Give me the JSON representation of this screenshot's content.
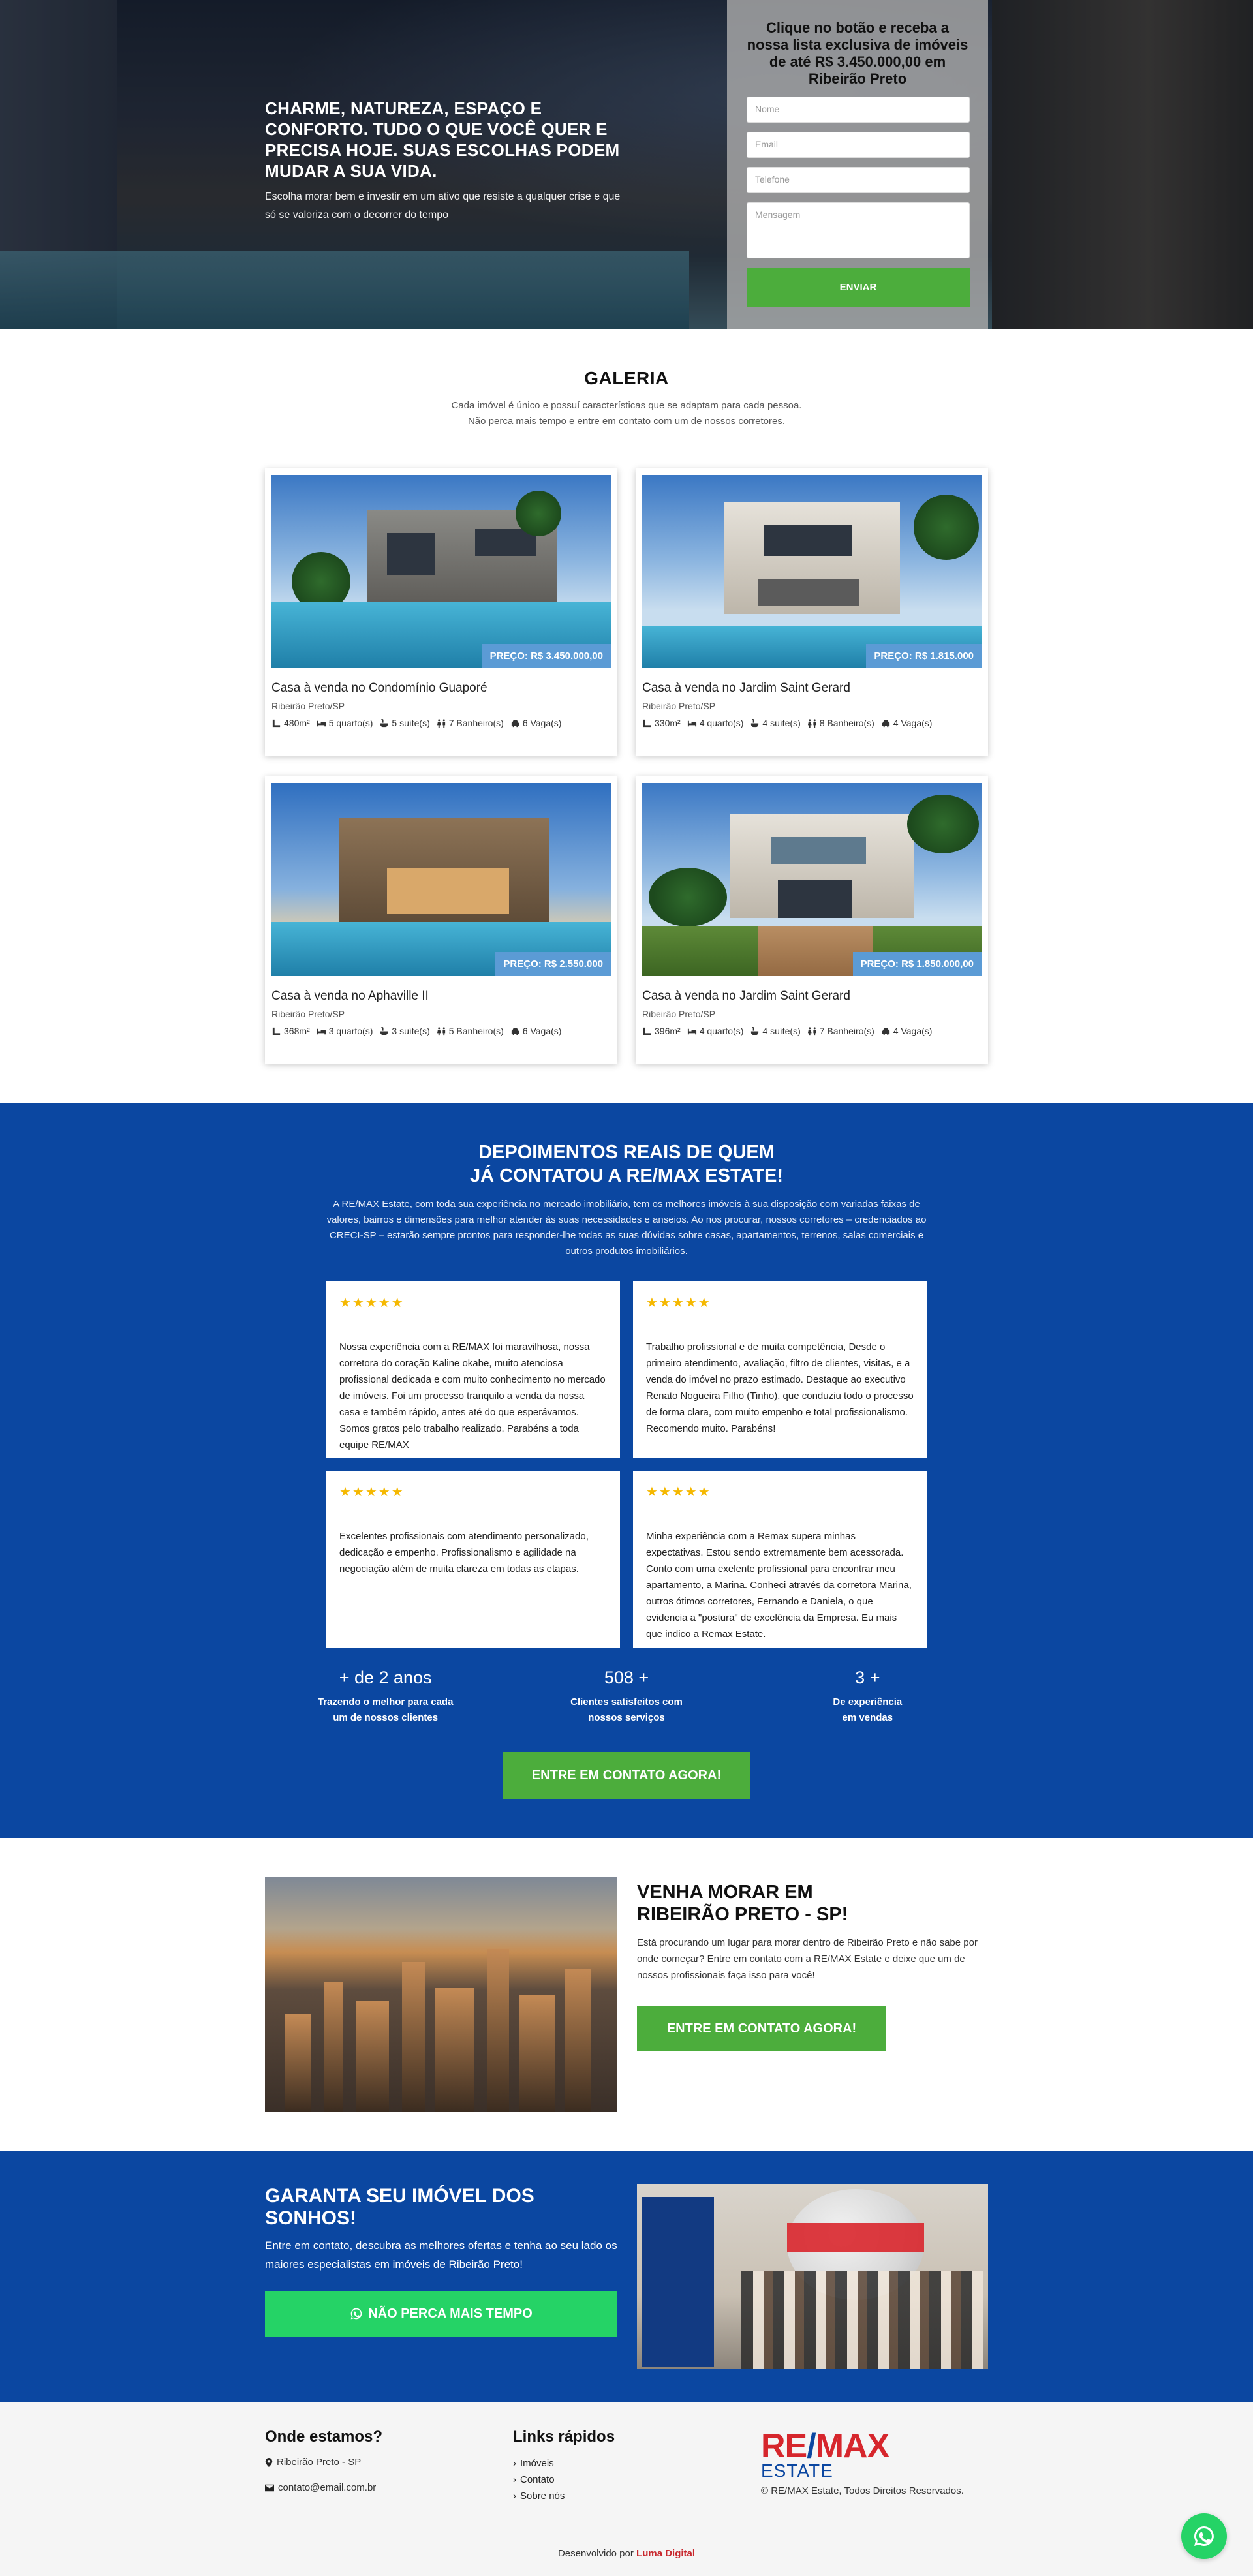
{
  "hero": {
    "headline": "CHARME, NATUREZA, ESPAÇO E CONFORTO. TUDO O QUE VOCÊ QUER E PRECISA HOJE. SUAS ESCOLHAS PODEM MUDAR A SUA VIDA.",
    "text": "Escolha morar bem e investir em um ativo que resiste a qualquer crise e que só se valoriza com o decorrer do tempo"
  },
  "form": {
    "title": "Clique no botão e receba a nossa lista exclusiva de imóveis de até R$ 3.450.000,00 em Ribeirão Preto",
    "name_placeholder": "Nome",
    "email_placeholder": "Email",
    "phone_placeholder": "Telefone",
    "message_placeholder": "Mensagem",
    "submit": "ENVIAR"
  },
  "gallery": {
    "title": "GALERIA",
    "subtitle_1": "Cada imóvel é único e possuí características que se adaptam para cada pessoa.",
    "subtitle_2": "Não perca mais tempo e entre em contato com um de nossos corretores.",
    "cards": [
      {
        "price": "PREÇO: R$ 3.450.000,00",
        "title": "Casa à venda no Condomínio Guaporé",
        "city": "Ribeirão Preto/SP",
        "area": "480m²",
        "bedrooms": "5 quarto(s)",
        "suites": "5 suíte(s)",
        "bathrooms": "7 Banheiro(s)",
        "parking": "6 Vaga(s)"
      },
      {
        "price": "PREÇO: R$ 1.815.000",
        "title": "Casa à venda no Jardim Saint Gerard",
        "city": "Ribeirão Preto/SP",
        "area": "330m²",
        "bedrooms": "4 quarto(s)",
        "suites": "4 suíte(s)",
        "bathrooms": "8 Banheiro(s)",
        "parking": "4 Vaga(s)"
      },
      {
        "price": "PREÇO: R$ 2.550.000",
        "title": "Casa à venda no Aphaville II",
        "city": "Ribeirão Preto/SP",
        "area": "368m²",
        "bedrooms": "3 quarto(s)",
        "suites": "3 suíte(s)",
        "bathrooms": "5 Banheiro(s)",
        "parking": "6 Vaga(s)"
      },
      {
        "price": "PREÇO: R$ 1.850.000,00",
        "title": "Casa à venda no Jardim Saint Gerard",
        "city": "Ribeirão Preto/SP",
        "area": "396m²",
        "bedrooms": "4 quarto(s)",
        "suites": "4 suíte(s)",
        "bathrooms": "7 Banheiro(s)",
        "parking": "4 Vaga(s)"
      }
    ]
  },
  "testimonials": {
    "title_1": "DEPOIMENTOS REAIS DE QUEM",
    "title_2": "JÁ CONTATOU A RE/MAX ESTATE!",
    "lead": "A RE/MAX Estate, com toda sua experiência no mercado imobiliário, tem os melhores imóveis à sua disposição com variadas faixas de valores, bairros e dimensões para melhor atender às suas necessidades e anseios. Ao nos procurar, nossos corretores – credenciados ao CRECI-SP – estarão sempre prontos para responder-lhe todas as suas dúvidas sobre casas, apartamentos, terrenos, salas comerciais e outros produtos imobiliários.",
    "stars": "★★★★★",
    "items": [
      {
        "text": "Nossa experiência com a RE/MAX foi maravilhosa, nossa corretora do coração Kaline okabe, muito atenciosa profissional dedicada e com muito conhecimento no mercado de imóveis. Foi um processo tranquilo a venda da nossa casa e também rápido, antes até do que esperávamos. Somos gratos pelo trabalho realizado. Parabéns a toda equipe RE/MAX"
      },
      {
        "text": "Trabalho profissional e de muita competência, Desde o primeiro atendimento, avaliação, filtro de clientes, visitas, e a venda do imóvel no prazo estimado. Destaque ao executivo Renato Nogueira Filho (Tinho), que conduziu todo o processo de forma clara, com muito empenho e total profissionalismo. Recomendo muito. Parabéns!"
      },
      {
        "text": "Excelentes profissionais com atendimento personalizado, dedicação e empenho. Profissionalismo e agilidade na negociação além de muita clareza em todas as etapas."
      },
      {
        "text": "Minha experiência com a Remax supera minhas expectativas. Estou sendo extremamente bem acessorada. Conto com uma exelente profissional para encontrar meu apartamento, a Marina. Conheci através da corretora Marina, outros ótimos corretores, Fernando e Daniela, o que evidencia a \"postura\" de excelência da Empresa. Eu mais que indico a Remax Estate."
      }
    ],
    "stats": [
      {
        "num": "+ de 2 anos",
        "label_1": "Trazendo o melhor para cada",
        "label_2": "um de nossos clientes"
      },
      {
        "num": "508 +",
        "label_1": "Clientes satisfeitos com",
        "label_2": "nossos serviços"
      },
      {
        "num": "3 +",
        "label_1": "De experiência",
        "label_2": "em vendas"
      }
    ],
    "cta": "ENTRE EM CONTATO AGORA!"
  },
  "venha": {
    "title_1": "VENHA MORAR EM",
    "title_2": "RIBEIRÃO PRETO - SP!",
    "text": "Está procurando um lugar para morar dentro de Ribeirão Preto e não sabe por onde começar? Entre em contato com a RE/MAX Estate e deixe que um de nossos profissionais faça isso para você!",
    "cta": "ENTRE EM CONTATO AGORA!"
  },
  "dreams": {
    "title": "GARANTA SEU IMÓVEL DOS SONHOS!",
    "text": "Entre em contato, descubra as melhores ofertas e tenha ao seu lado os maiores especialistas em imóveis de Ribeirão Preto!",
    "cta": "NÃO PERCA MAIS TEMPO"
  },
  "footer": {
    "where_title": "Onde estamos?",
    "address": "Ribeirão Preto - SP",
    "email": "contato@email.com.br",
    "links_title": "Links rápidos",
    "links": [
      "Imóveis",
      "Contato",
      "Sobre nós"
    ],
    "logo_re": "RE",
    "logo_slash": "/",
    "logo_max": "MAX",
    "logo_estate": "ESTATE",
    "copyright": "© RE/MAX Estate, Todos Direitos Reservados.",
    "credit_prefix": "Desenvolvido por",
    "credit_name": "Luma Digital"
  },
  "colors": {
    "brand_blue": "#0b47a1",
    "green": "#4cad3c",
    "whatsapp": "#25d366",
    "red": "#d6262c",
    "price_tag": "#5b9bd5"
  }
}
